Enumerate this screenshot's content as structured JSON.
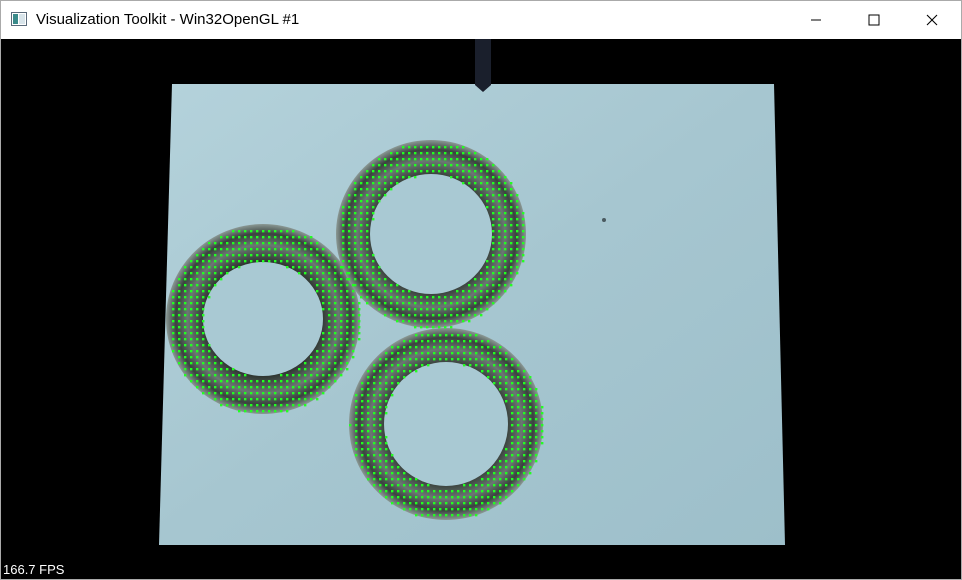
{
  "window": {
    "title": "Visualization Toolkit - Win32OpenGL #1",
    "icon": "vtk-app-icon",
    "controls": [
      "minimize-icon",
      "maximize-icon",
      "close-icon"
    ]
  },
  "viewport": {
    "fps_text": "166.7 FPS",
    "background_color": "#000000",
    "board_color": "#a9c9d3",
    "overlay_point_color": "#22ff22"
  }
}
